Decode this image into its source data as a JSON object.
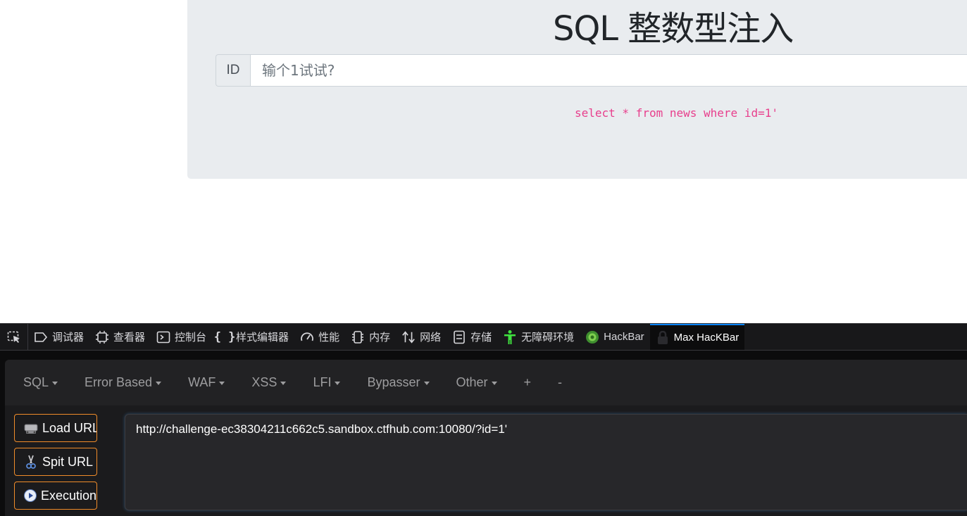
{
  "page": {
    "title": "SQL 整数型注入",
    "id_label": "ID",
    "id_placeholder": "输个1试试?",
    "sql_query": "select * from news where id=1'"
  },
  "devtools": {
    "tabs": [
      {
        "label": "调试器",
        "icon": "debugger-icon"
      },
      {
        "label": "查看器",
        "icon": "inspector-icon"
      },
      {
        "label": "控制台",
        "icon": "console-icon"
      },
      {
        "label": "样式编辑器",
        "icon": "style-editor-icon"
      },
      {
        "label": "性能",
        "icon": "performance-icon"
      },
      {
        "label": "内存",
        "icon": "memory-icon"
      },
      {
        "label": "网络",
        "icon": "network-icon"
      },
      {
        "label": "存储",
        "icon": "storage-icon"
      },
      {
        "label": "无障碍环境",
        "icon": "accessibility-icon"
      },
      {
        "label": "HackBar",
        "icon": "hackbar-icon"
      },
      {
        "label": "Max HacKBar",
        "icon": "max-hackbar-icon",
        "active": true
      }
    ],
    "accent_color": "#0a84ff"
  },
  "hackbar": {
    "menu": [
      {
        "label": "SQL",
        "dropdown": true
      },
      {
        "label": "Error Based",
        "dropdown": true
      },
      {
        "label": "WAF",
        "dropdown": true
      },
      {
        "label": "XSS",
        "dropdown": true
      },
      {
        "label": "LFI",
        "dropdown": true
      },
      {
        "label": "Bypasser",
        "dropdown": true
      },
      {
        "label": "Other",
        "dropdown": true
      },
      {
        "label": "+",
        "dropdown": false
      },
      {
        "label": "-",
        "dropdown": false
      }
    ],
    "buttons": {
      "load_url": "Load URL",
      "split_url": "Spit URL",
      "execution": "Execution"
    },
    "url_value": "http://challenge-ec38304211c662c5.sandbox.ctfhub.com:10080/?id=1'",
    "button_border_color": "#f08c2a"
  }
}
